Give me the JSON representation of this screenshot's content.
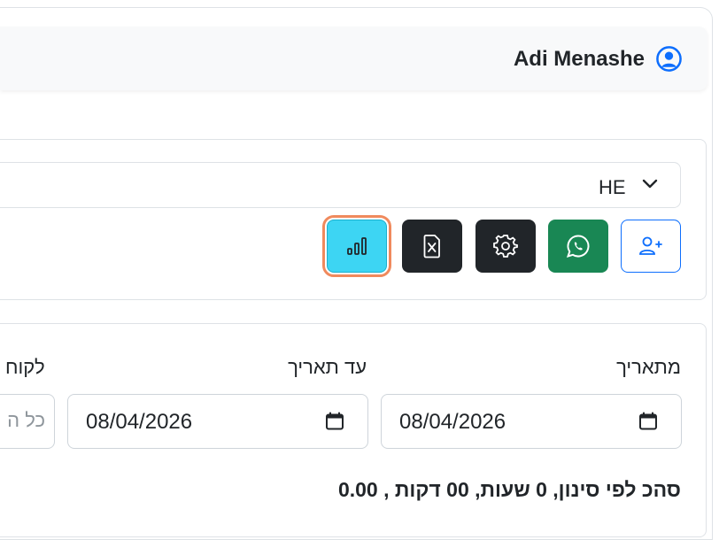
{
  "header": {
    "user_name": "Adi Menashe"
  },
  "language": {
    "selected": "HE"
  },
  "toolbar": {
    "buttons": [
      {
        "name": "statistics",
        "icon": "bar-chart-icon",
        "color": "#3dd5f3"
      },
      {
        "name": "export-excel",
        "icon": "file-excel-icon",
        "color": "#212529"
      },
      {
        "name": "settings",
        "icon": "gear-icon",
        "color": "#212529"
      },
      {
        "name": "whatsapp",
        "icon": "whatsapp-icon",
        "color": "#198754"
      },
      {
        "name": "add-user",
        "icon": "person-plus-icon",
        "color": "#0d6efd"
      }
    ]
  },
  "filters": {
    "from_label": "מתאריך",
    "from_value": "08/04/2026",
    "to_label": "עד תאריך",
    "to_value": "08/04/2026",
    "client_label": "לקוח",
    "client_placeholder": "כל ה"
  },
  "summary": {
    "text": "סהכ לפי סינון, 0 שעות, 00 דקות , 0.00"
  }
}
